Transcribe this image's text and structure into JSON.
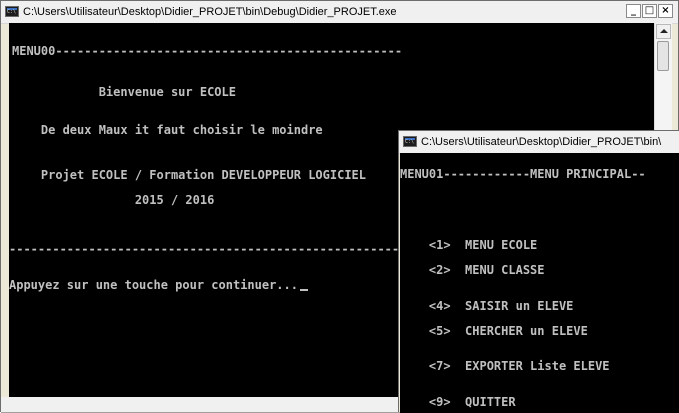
{
  "back_window": {
    "title": "C:\\Users\\Utilisateur\\Desktop\\Didier_PROJET\\bin\\Debug\\Didier_PROJET.exe",
    "controls": {
      "minimize": "_",
      "maximize": "□",
      "close": "×"
    },
    "lines": {
      "menu_header": "MENU00------------------------------------------------",
      "welcome": "            Bienvenue sur ECOLE",
      "proverb": "    De deux Maux it faut choisir le moindre",
      "project": "    Projet ECOLE / Formation DEVELOPPEUR LOGICIEL",
      "years": "                 2015 / 2016",
      "separator": "--------------------------------------------------------------------------------",
      "prompt": "Appuyez sur une touche pour continuer..."
    }
  },
  "front_window": {
    "title": "C:\\Users\\Utilisateur\\Desktop\\Didier_PROJET\\bin\\",
    "lines": {
      "menu_header": "MENU01------------MENU PRINCIPAL--",
      "items": [
        "    <1>  MENU ECOLE",
        "    <2>  MENU CLASSE",
        "    <4>  SAISIR un ELEVE",
        "    <5>  CHERCHER un ELEVE",
        "    <7>  EXPORTER Liste ELEVE",
        "    <9>  QUITTER"
      ]
    }
  }
}
